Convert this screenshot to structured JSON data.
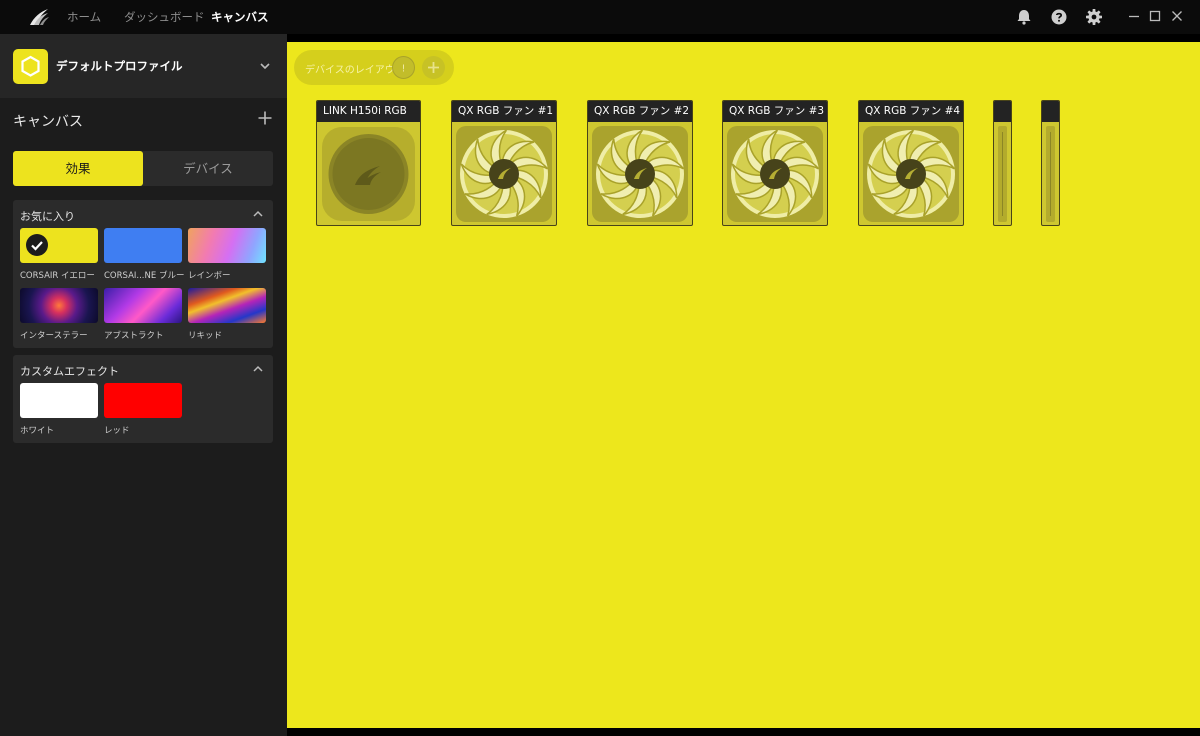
{
  "nav": {
    "home": "ホーム",
    "dashboard": "ダッシュボード",
    "canvas": "キャンバス"
  },
  "profile": {
    "name": "デフォルトプロファイル"
  },
  "canvas": {
    "title": "キャンバス"
  },
  "tabs": {
    "effects": "効果",
    "devices": "デバイス"
  },
  "favorites": {
    "title": "お気に入り",
    "items": [
      {
        "label": "CORSAIR イエロー"
      },
      {
        "label": "CORSAI...NE ブルー"
      },
      {
        "label": "レインボー"
      },
      {
        "label": "インターステラー"
      },
      {
        "label": "アブストラクト"
      },
      {
        "label": "リキッド"
      }
    ]
  },
  "custom": {
    "title": "カスタムエフェクト",
    "items": [
      {
        "label": "ホワイト"
      },
      {
        "label": "レッド"
      }
    ]
  },
  "layout": {
    "label": "デバイスのレイアウト",
    "info": "!"
  },
  "devices": [
    {
      "name": "LINK H150i RGB"
    },
    {
      "name": "QX RGB ファン #1"
    },
    {
      "name": "QX RGB ファン #2"
    },
    {
      "name": "QX RGB ファン #3"
    },
    {
      "name": "QX RGB ファン #4"
    }
  ],
  "colors": {
    "accent": "#ede31e",
    "canvas": "#ede71c",
    "sidebar": "#1c1c1c",
    "panel": "#2b2b2b",
    "titlebar": "#0b0b0b"
  }
}
